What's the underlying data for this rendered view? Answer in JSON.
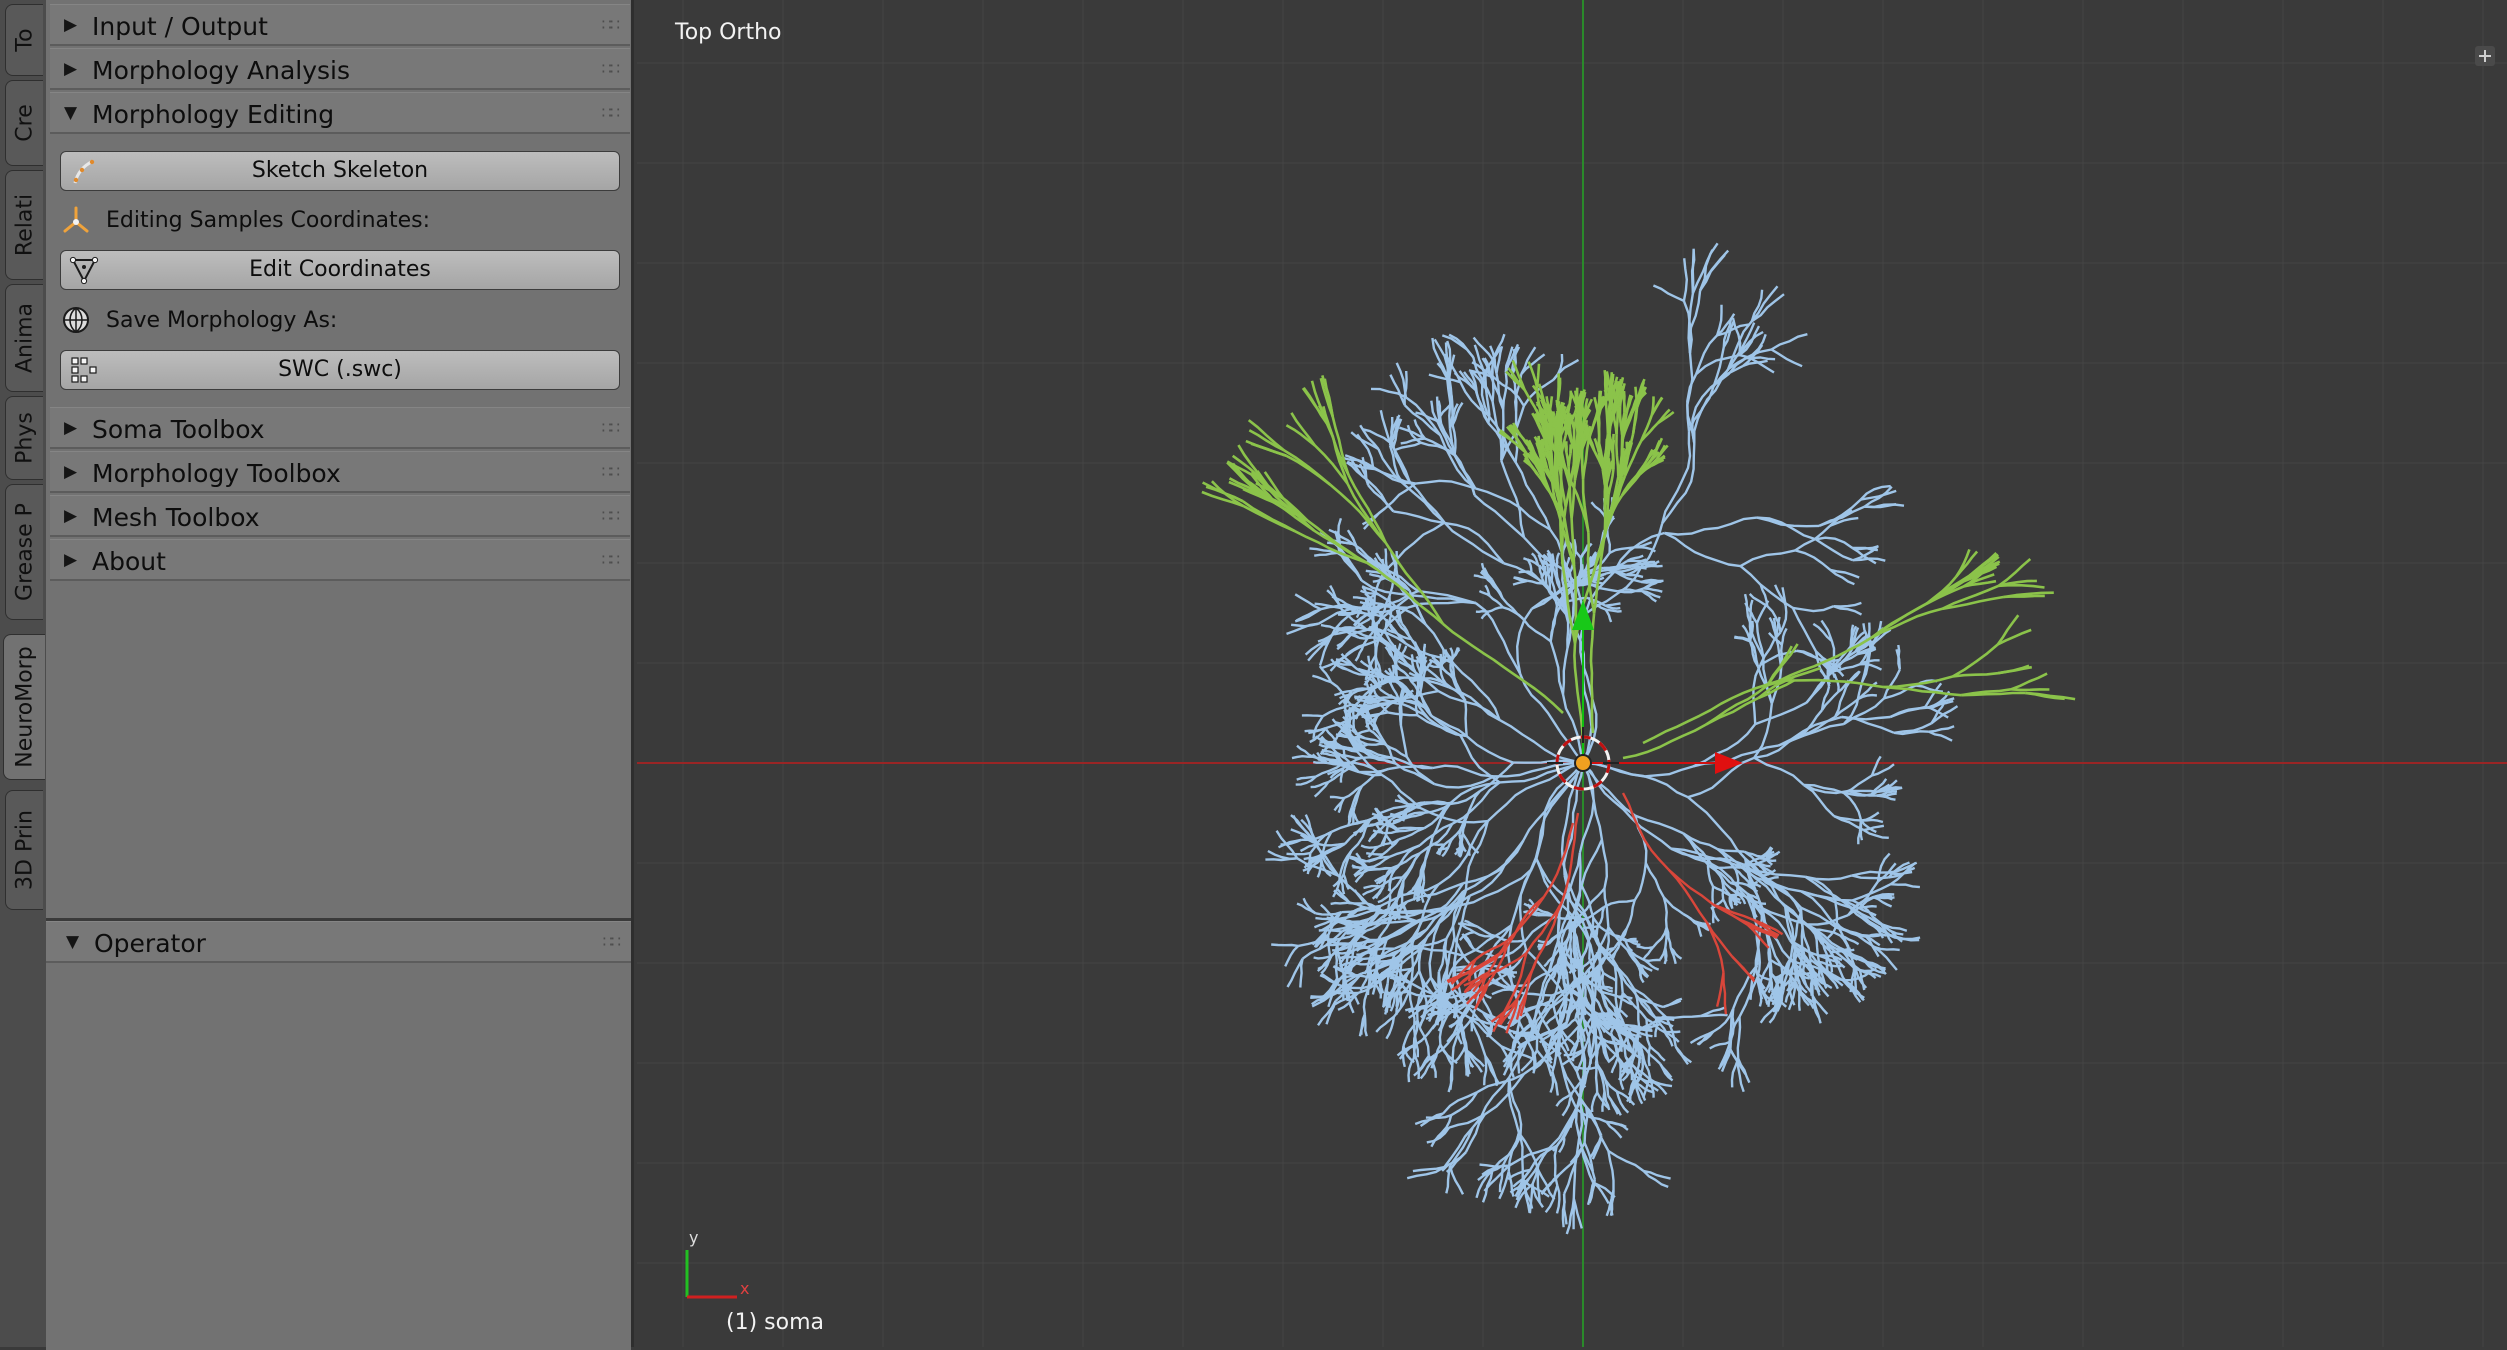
{
  "tabs": [
    {
      "label": "To",
      "active": false
    },
    {
      "label": "Cre",
      "active": false
    },
    {
      "label": "Relati",
      "active": false
    },
    {
      "label": "Anima",
      "active": false
    },
    {
      "label": "Phys",
      "active": false
    },
    {
      "label": "Grease P",
      "active": false
    },
    {
      "label": "NeuroMorp",
      "active": true
    },
    {
      "label": "3D Prin",
      "active": false
    }
  ],
  "panel": {
    "sections": [
      {
        "label": "Input / Output",
        "expanded": false
      },
      {
        "label": "Morphology Analysis",
        "expanded": false
      },
      {
        "label": "Morphology Editing",
        "expanded": true
      },
      {
        "label": "Soma Toolbox",
        "expanded": false
      },
      {
        "label": "Morphology Toolbox",
        "expanded": false
      },
      {
        "label": "Mesh Toolbox",
        "expanded": false
      },
      {
        "label": "About",
        "expanded": false
      }
    ],
    "editing": {
      "sketch_button": "Sketch Skeleton",
      "coords_label": "Editing Samples Coordinates:",
      "edit_button": "Edit Coordinates",
      "save_label": "Save Morphology As:",
      "swc_button": "SWC (.swc)"
    },
    "operator": {
      "label": "Operator",
      "expanded": true
    }
  },
  "viewport": {
    "view_name": "Top Ortho",
    "object_label": "(1) soma",
    "axis_x": "x",
    "axis_y": "y",
    "colors": {
      "apical": "#8bc34a",
      "basal": "#9fc5e8",
      "axon": "#d9463a",
      "x_axis": "#c62828",
      "y_axis": "#2e9b2e"
    }
  }
}
